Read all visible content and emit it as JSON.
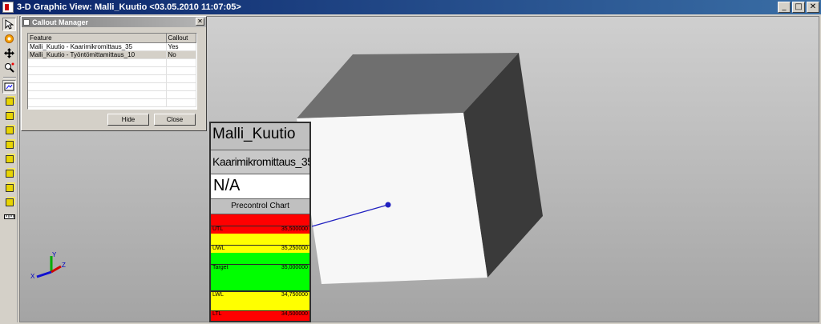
{
  "window": {
    "title": "3-D Graphic View: Malli_Kuutio <03.05.2010 11:07:05>",
    "buttons": {
      "minimize": "_",
      "maximize": "□",
      "close": "✕"
    }
  },
  "toolbar": {
    "tools": [
      "pointer-icon",
      "target-icon",
      "pan-icon",
      "zoom-icon",
      "view-icon",
      "cube-front-icon",
      "cube-back-icon",
      "cube-left-icon",
      "cube-right-icon",
      "cube-top-icon",
      "cube-bottom-icon",
      "cube-iso-icon",
      "cube-rotate-icon",
      "ruler-icon"
    ]
  },
  "callout_manager": {
    "title": "Callout Manager",
    "close_label": "✕",
    "columns": [
      "Feature",
      "Callout"
    ],
    "rows": [
      {
        "feature": "Malli_Kuutio - Kaarimikromittaus_35",
        "callout": "Yes"
      },
      {
        "feature": "Malli_Kuutio - Työntömittamittaus_10",
        "callout": "No"
      }
    ],
    "hide_label": "Hide",
    "close_button_label": "Close"
  },
  "callout": {
    "model": "Malli_Kuutio",
    "feature": "Kaarimikromittaus_35",
    "value": "N/A",
    "chart_title": "Precontrol Chart",
    "lines": [
      {
        "label": "UTL",
        "value": "35,500000"
      },
      {
        "label": "UWL",
        "value": "35,250000"
      },
      {
        "label": "Target",
        "value": "35,000000"
      },
      {
        "label": "LWL",
        "value": "34,750000"
      },
      {
        "label": "LTL",
        "value": "34,500000"
      }
    ],
    "colors": {
      "red": "#ff0000",
      "yellow": "#ffff00",
      "green": "#00ff00"
    }
  },
  "triad": {
    "x": "X",
    "y": "Y",
    "z": "Z"
  }
}
